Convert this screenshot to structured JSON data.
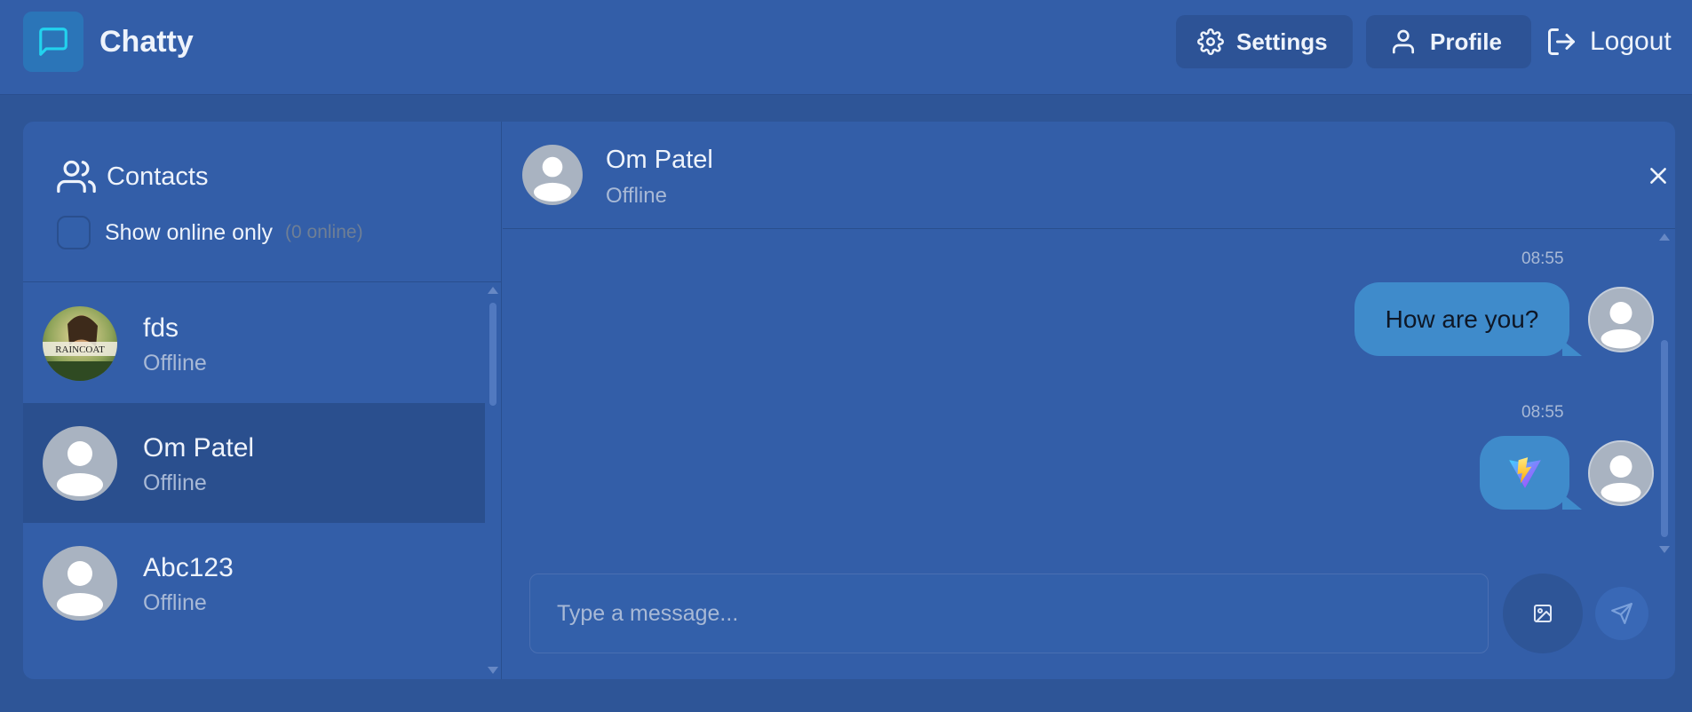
{
  "header": {
    "app_title": "Chatty",
    "logo_icon": "message-square-icon",
    "settings_label": "Settings",
    "profile_label": "Profile",
    "logout_label": "Logout"
  },
  "sidebar": {
    "title": "Contacts",
    "online_filter_label": "Show online only",
    "online_count": "(0 online)",
    "contacts": [
      {
        "name": "fds",
        "status": "Offline",
        "avatar": "photo-raincoat"
      },
      {
        "name": "Om Patel",
        "status": "Offline",
        "avatar": "default-avatar",
        "selected": true
      },
      {
        "name": "Abc123",
        "status": "Offline",
        "avatar": "default-avatar"
      }
    ]
  },
  "chat": {
    "contact_name": "Om Patel",
    "contact_status": "Offline",
    "messages": [
      {
        "time": "08:55",
        "text": "How are you?",
        "type": "text"
      },
      {
        "time": "08:55",
        "text": "",
        "type": "image",
        "image": "vite-logo"
      }
    ],
    "input_placeholder": "Type a message..."
  },
  "colors": {
    "background": "#2e5597",
    "panel": "#335ea8",
    "selected_row": "#2a4f8e",
    "bubble": "#3f8bcb",
    "logo_accent": "#22d3ee"
  }
}
